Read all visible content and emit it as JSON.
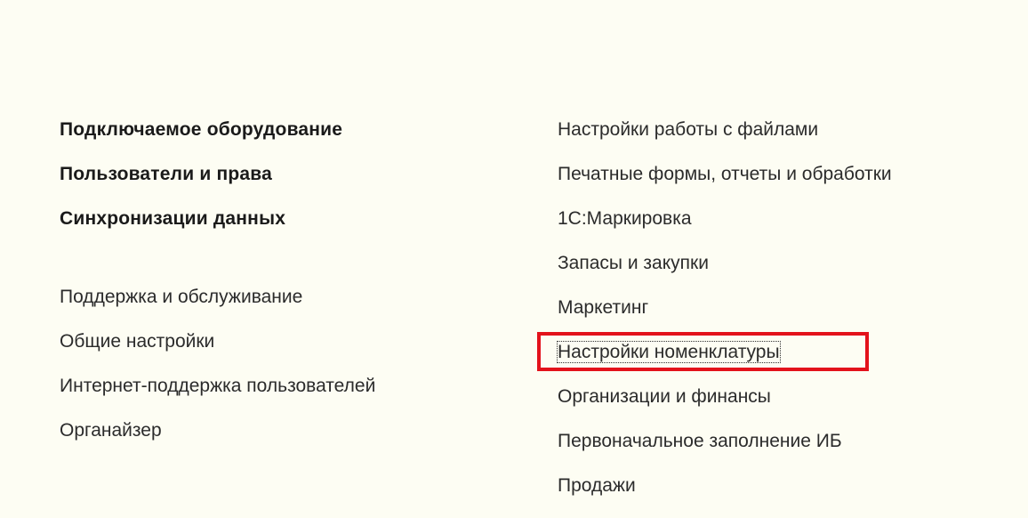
{
  "left_column": {
    "bold_items": [
      {
        "label": "Подключаемое оборудование"
      },
      {
        "label": "Пользователи и права"
      },
      {
        "label": "Синхронизации данных"
      }
    ],
    "items": [
      {
        "label": "Поддержка и обслуживание"
      },
      {
        "label": "Общие настройки"
      },
      {
        "label": "Интернет-поддержка пользователей"
      },
      {
        "label": "Органайзер"
      }
    ]
  },
  "right_column": {
    "items": [
      {
        "label": "Настройки работы с файлами"
      },
      {
        "label": "Печатные формы, отчеты и обработки"
      },
      {
        "label": "1С:Маркировка"
      },
      {
        "label": "Запасы и закупки"
      },
      {
        "label": "Маркетинг"
      },
      {
        "label": "Настройки номенклатуры"
      },
      {
        "label": "Организации и финансы"
      },
      {
        "label": "Первоначальное заполнение ИБ"
      },
      {
        "label": "Продажи"
      }
    ]
  },
  "highlight_color": "#e3121b",
  "background_color": "#fdfdf3"
}
